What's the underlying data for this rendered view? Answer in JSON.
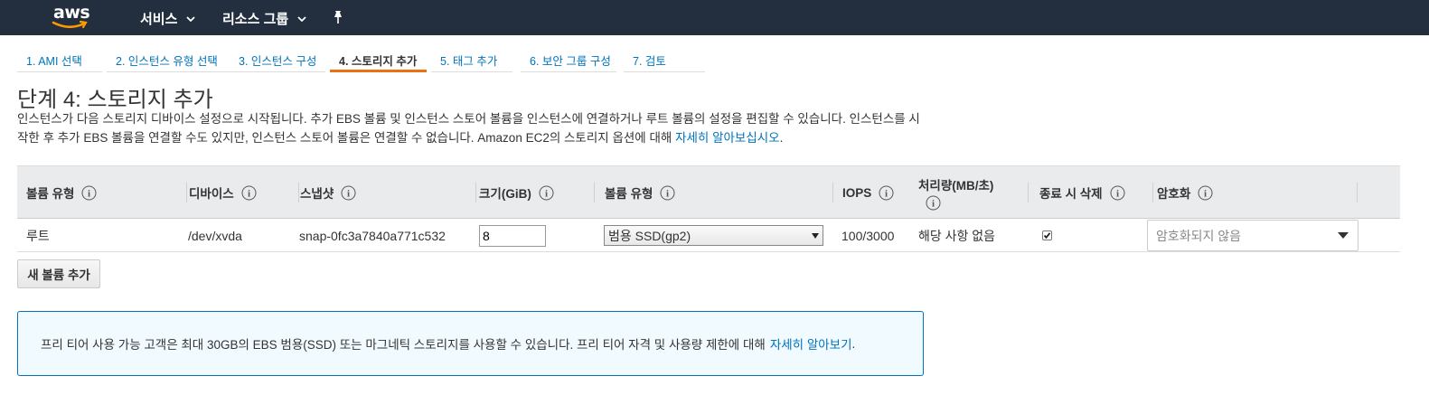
{
  "topnav": {
    "logo_text": "aws",
    "services_label": "서비스",
    "resource_groups_label": "리소스 그룹"
  },
  "steps": [
    {
      "label": "1. AMI 선택"
    },
    {
      "label": "2. 인스턴스 유형 선택"
    },
    {
      "label": "3. 인스턴스 구성"
    },
    {
      "label": "4. 스토리지 추가"
    },
    {
      "label": "5. 태그 추가"
    },
    {
      "label": "6. 보안 그룹 구성"
    },
    {
      "label": "7. 검토"
    }
  ],
  "active_step": 4,
  "page": {
    "title": "단계 4: 스토리지 추가",
    "description": "인스턴스가 다음 스토리지 디바이스 설정으로 시작됩니다. 추가 EBS 볼륨 및 인스턴스 스토어 볼륨을 인스턴스에 연결하거나 루트 볼륨의 설정을 편집할 수 있습니다. 인스턴스를 시작한 후 추가 EBS 볼륨을 연결할 수도 있지만, 인스턴스 스토어 볼륨은 연결할 수 없습니다. Amazon EC2의 스토리지 옵션에 대해",
    "learn_more_link": "자세히 알아보십시오",
    "trailing": "."
  },
  "table": {
    "headers": {
      "volume_type": "볼륨 유형",
      "device": "디바이스",
      "snapshot": "스냅샷",
      "size": "크기(GiB)",
      "volume_kind": "볼륨 유형",
      "iops": "IOPS",
      "throughput": "처리량(MB/초)",
      "delete_on_termination": "종료 시 삭제",
      "encryption": "암호화"
    },
    "rows": [
      {
        "volume_type": "루트",
        "device": "/dev/xvda",
        "snapshot": "snap-0fc3a7840a771c532",
        "size": "8",
        "volume_kind": "범용 SSD(gp2)",
        "iops": "100/3000",
        "throughput": "해당 사항 없음",
        "delete_on_termination": true,
        "encryption": "암호화되지 않음"
      }
    ]
  },
  "add_volume_button": "새 볼륨 추가",
  "notice": {
    "text": "프리 티어 사용 가능 고객은 최대 30GB의 EBS 범용(SSD) 또는 마그네틱 스토리지를 사용할 수 있습니다. 프리 티어 자격 및 사용량 제한에 대해",
    "link": "자세히 알아보기",
    "trailing": "."
  },
  "colors": {
    "nav_bg": "#232f3e",
    "accent": "#ec7211",
    "link": "#0073bb",
    "header_bg": "#e9ebed",
    "notice_bg": "#f1faff"
  }
}
